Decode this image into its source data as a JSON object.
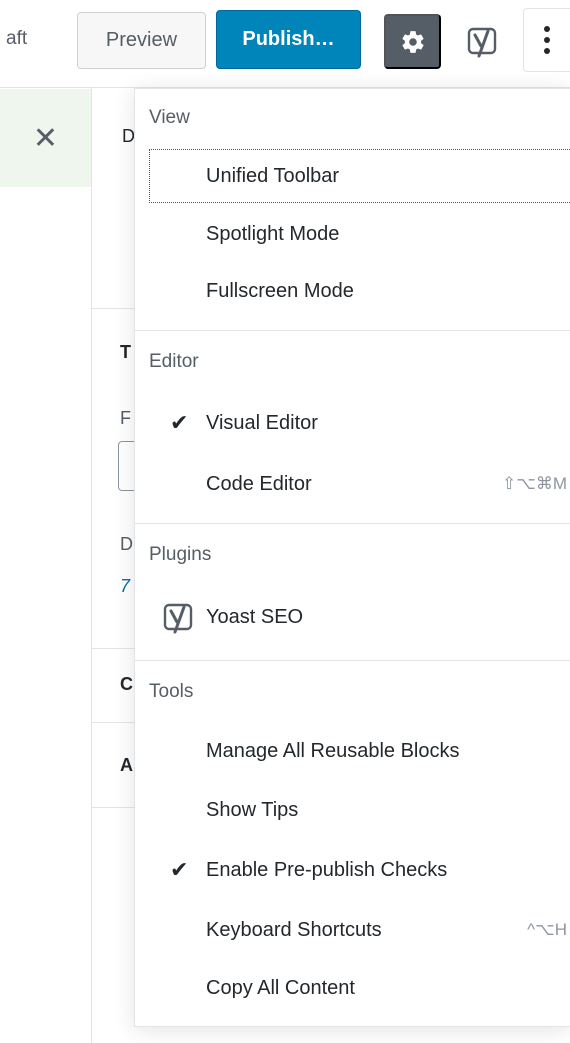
{
  "toolbar": {
    "draft_label": "aft",
    "preview_label": "Preview",
    "publish_label": "Publish…",
    "settings_icon": "gear-icon",
    "yoast_icon": "yoast-icon",
    "more_icon": "more-vertical-icon"
  },
  "sidebar": {
    "close_label": "✕",
    "peeks": [
      "D",
      "T",
      "F",
      "D",
      "7",
      "C",
      "A"
    ]
  },
  "menu": {
    "groups": [
      {
        "label": "View",
        "items": [
          {
            "label": "Unified Toolbar",
            "checked": false,
            "shortcut": ""
          },
          {
            "label": "Spotlight Mode",
            "checked": false,
            "shortcut": ""
          },
          {
            "label": "Fullscreen Mode",
            "checked": false,
            "shortcut": ""
          }
        ]
      },
      {
        "label": "Editor",
        "items": [
          {
            "label": "Visual Editor",
            "checked": true,
            "shortcut": ""
          },
          {
            "label": "Code Editor",
            "checked": false,
            "shortcut": "⇧⌥⌘M"
          }
        ]
      },
      {
        "label": "Plugins",
        "items": [
          {
            "label": "Yoast SEO",
            "checked": false,
            "shortcut": ""
          }
        ]
      },
      {
        "label": "Tools",
        "items": [
          {
            "label": "Manage All Reusable Blocks",
            "checked": false,
            "shortcut": ""
          },
          {
            "label": "Show Tips",
            "checked": false,
            "shortcut": ""
          },
          {
            "label": "Enable Pre-publish Checks",
            "checked": true,
            "shortcut": ""
          },
          {
            "label": "Keyboard Shortcuts",
            "checked": false,
            "shortcut": "^⌥H"
          },
          {
            "label": "Copy All Content",
            "checked": false,
            "shortcut": ""
          }
        ]
      }
    ],
    "check_glyph": "✔"
  }
}
